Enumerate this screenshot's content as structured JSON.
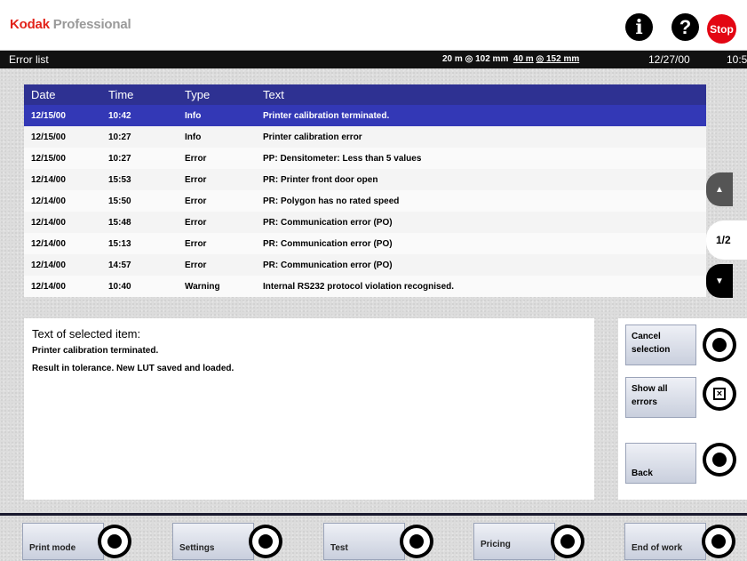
{
  "header": {
    "brand": "Kodak",
    "brand_rest": " Professional",
    "info_icon": "i",
    "help_icon": "?",
    "stop_label": "Stop"
  },
  "titlebar": {
    "title": "Error list",
    "media_a": "20 m",
    "media_a_width": " 102 mm",
    "media_b": "40 m",
    "media_b_width": " 152 mm",
    "date": "12/27/00",
    "time": "10:5"
  },
  "table": {
    "columns": [
      "Date",
      "Time",
      "Type",
      "Text"
    ],
    "rows": [
      {
        "date": "12/15/00",
        "time": "10:42",
        "type": "Info",
        "text": "Printer calibration terminated."
      },
      {
        "date": "12/15/00",
        "time": "10:27",
        "type": "Info",
        "text": "Printer calibration error"
      },
      {
        "date": "12/15/00",
        "time": "10:27",
        "type": "Error",
        "text": "PP: Densitometer: Less than 5 values"
      },
      {
        "date": "12/14/00",
        "time": "15:53",
        "type": "Error",
        "text": "PR: Printer front door open"
      },
      {
        "date": "12/14/00",
        "time": "15:50",
        "type": "Error",
        "text": "PR: Polygon has no rated speed"
      },
      {
        "date": "12/14/00",
        "time": "15:48",
        "type": "Error",
        "text": "PR: Communication error (PO)"
      },
      {
        "date": "12/14/00",
        "time": "15:13",
        "type": "Error",
        "text": "PR: Communication error (PO)"
      },
      {
        "date": "12/14/00",
        "time": "14:57",
        "type": "Error",
        "text": "PR: Communication error (PO)"
      },
      {
        "date": "12/14/00",
        "time": "10:40",
        "type": "Warning",
        "text": "Internal RS232 protocol violation recognised."
      }
    ]
  },
  "pager": {
    "label": "1/2",
    "up_icon": "▲",
    "down_icon": "▼"
  },
  "detail": {
    "heading": "Text of selected item:",
    "line1": "Printer calibration terminated.",
    "line2": "Result in tolerance. New LUT saved and loaded."
  },
  "side_buttons": {
    "cancel": "Cancel selection",
    "show_all": "Show all errors",
    "back": "Back"
  },
  "bottom_buttons": [
    "Print mode",
    "Settings",
    "Test",
    "Pricing",
    "End of work"
  ],
  "colors": {
    "table_header": "#2e3192",
    "selected_row": "#3338b6",
    "stop": "#e30613",
    "brand": "#e2231a"
  }
}
